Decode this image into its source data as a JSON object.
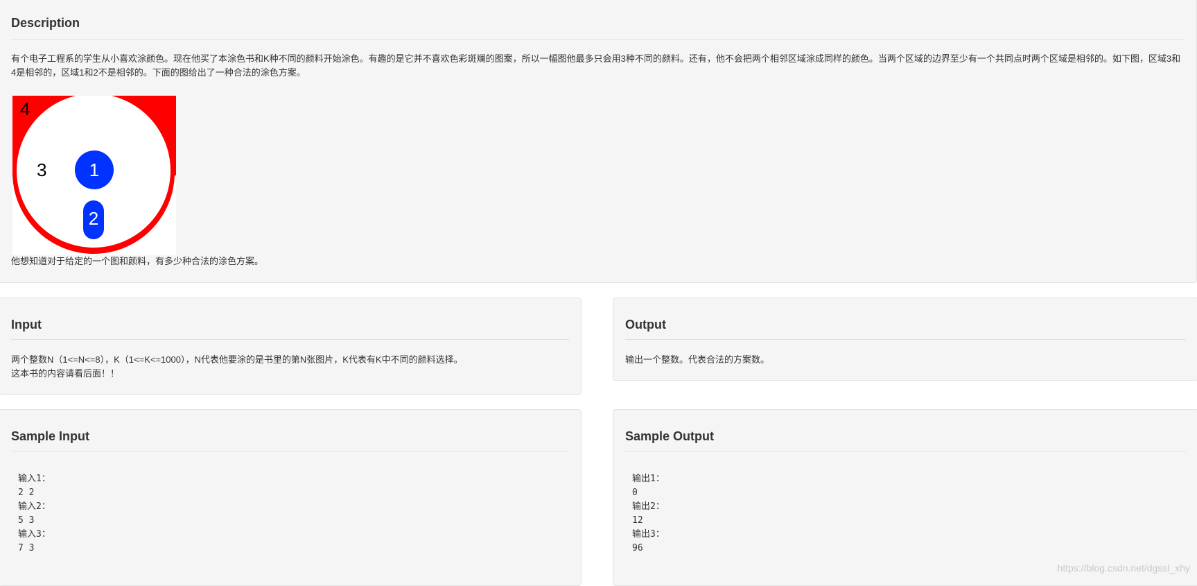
{
  "description": {
    "title": "Description",
    "paragraph": "有个电子工程系的学生从小喜欢涂颜色。现在他买了本涂色书和K种不同的颜料开始涂色。有趣的是它并不喜欢色彩斑斓的图案，所以一幅图他最多只会用3种不同的颜料。还有，他不会把两个相邻区域涂成同样的颜色。当两个区域的边界至少有一个共同点时两个区域是相邻的。如下图，区域3和4是相邻的，区域1和2不是相邻的。下面的图给出了一种合法的涂色方案。",
    "question": "他想知道对于给定的一个图和颜料，有多少种合法的涂色方案。",
    "figure": {
      "labels": [
        "4",
        "3",
        "1",
        "2"
      ],
      "colors": {
        "outer": "#ff0000",
        "inner": "#ffffff",
        "blobs": "#0033ff"
      }
    }
  },
  "input": {
    "title": "Input",
    "lines": [
      "两个整数N（1<=N<=8），K（1<=K<=1000），N代表他要涂的是书里的第N张图片，K代表有K中不同的颜料选择。",
      "这本书的内容请看后面！！"
    ]
  },
  "output": {
    "title": "Output",
    "text": "输出一个整数。代表合法的方案数。"
  },
  "sample_input": {
    "title": "Sample Input",
    "lines": [
      "输入1：",
      "2 2",
      "输入2：",
      "5 3",
      "输入3：",
      "7 3"
    ]
  },
  "sample_output": {
    "title": "Sample Output",
    "lines": [
      "输出1：",
      "0",
      "输出2：",
      "12",
      "输出3：",
      "96"
    ]
  },
  "watermark": "https://blog.csdn.net/dgssl_xhy"
}
